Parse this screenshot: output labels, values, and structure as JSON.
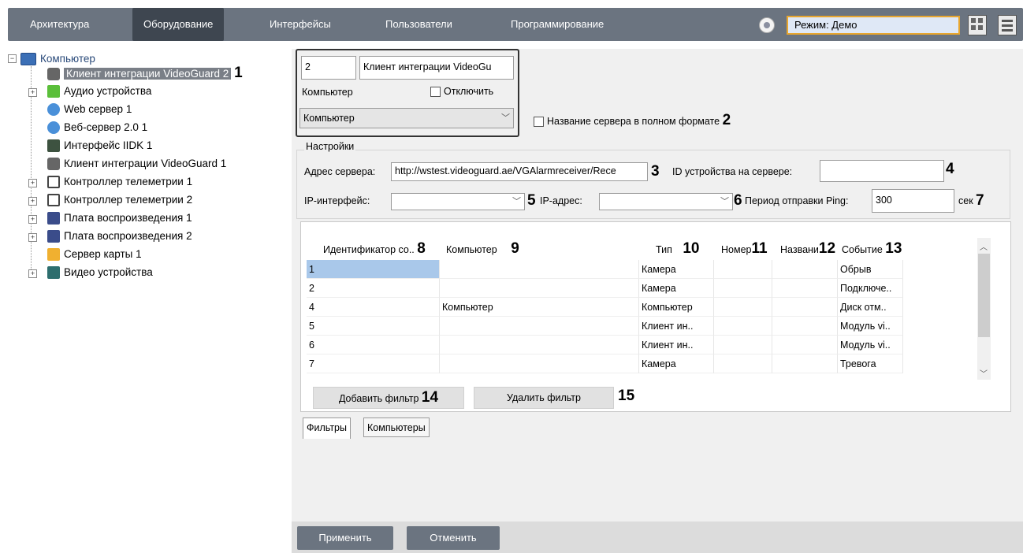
{
  "menu": {
    "items": [
      "Архитектура",
      "Оборудование",
      "Интерфейсы",
      "Пользователи",
      "Программирование"
    ],
    "mode_label": "Режим: Демо"
  },
  "tree": {
    "root": "Компьютер",
    "items": [
      "Клиент интеграции VideoGuard 2",
      "Аудио устройства",
      "Web сервер 1",
      "Веб-сервер 2.0 1",
      "Интерфейс IIDK 1",
      "Клиент интеграции VideoGuard 1",
      "Контроллер телеметрии 1",
      "Контроллер телеметрии 2",
      "Плата воспроизведения 1",
      "Плата воспроизведения 2",
      "Сервер карты 1",
      "Видео устройства"
    ]
  },
  "callouts": [
    "1",
    "2",
    "3",
    "4",
    "5",
    "6",
    "7",
    "8",
    "9",
    "10",
    "11",
    "12",
    "13",
    "14",
    "15"
  ],
  "object": {
    "id": "2",
    "name": "Клиент интеграции VideoGu",
    "parent_label": "Компьютер",
    "disable_label": "Отключить",
    "parent_value": "Компьютер",
    "full_name_label": "Название сервера в полном формате"
  },
  "settings": {
    "group_label": "Настройки",
    "server_addr_label": "Адрес сервера:",
    "server_addr_value": "http://wstest.videoguard.ae/VGAlarmreceiver/Rece",
    "device_id_label": "ID устройства на сервере:",
    "device_id_value": "",
    "ip_iface_label": "IP-интерфейс:",
    "ip_addr_label": "IP-адрес:",
    "ping_label": "Период отправки Ping:",
    "ping_value": "300",
    "ping_unit": "сек"
  },
  "table": {
    "headers": [
      "Идентификатор со..",
      "Компьютер",
      "Тип",
      "Номер",
      "Названи",
      "Событие"
    ],
    "rows": [
      [
        "1",
        "",
        "Камера",
        "",
        "",
        "Обрыв"
      ],
      [
        "2",
        "",
        "Камера",
        "",
        "",
        "Подключе.."
      ],
      [
        "4",
        "Компьютер",
        "Компьютер",
        "",
        "",
        "Диск отм.."
      ],
      [
        "5",
        "",
        "Клиент ин..",
        "",
        "",
        "Модуль vi.."
      ],
      [
        "6",
        "",
        "Клиент ин..",
        "",
        "",
        "Модуль vi.."
      ],
      [
        "7",
        "",
        "Камера",
        "",
        "",
        "Тревога"
      ]
    ]
  },
  "buttons": {
    "add_filter": "Добавить фильтр",
    "remove_filter": "Удалить фильтр",
    "apply": "Применить",
    "cancel": "Отменить"
  },
  "tabs": [
    "Фильтры",
    "Компьютеры"
  ]
}
